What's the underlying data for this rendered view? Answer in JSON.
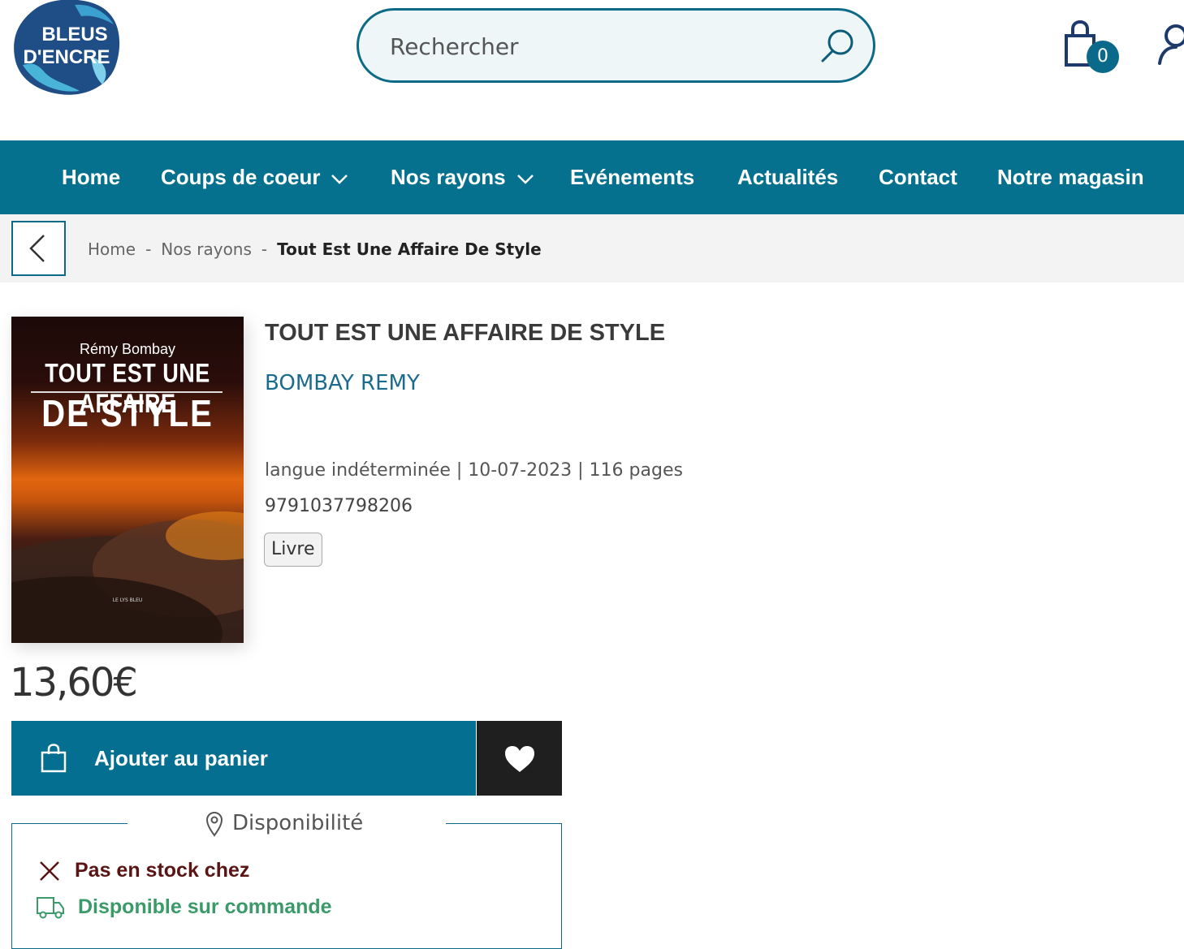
{
  "brand": {
    "logo_line1": "BLEUS",
    "logo_line2": "D'ENCRE"
  },
  "search": {
    "placeholder": "Rechercher"
  },
  "cart": {
    "count": "0"
  },
  "colors": {
    "primary": "#06718f",
    "dark": "#1f1f1f",
    "unavailable": "#5a1414",
    "available": "#3a9a68"
  },
  "nav": {
    "items": [
      {
        "label": "Home"
      },
      {
        "label": "Coups de coeur",
        "dropdown": true
      },
      {
        "label": "Nos rayons",
        "dropdown": true
      },
      {
        "label": "Evénements"
      },
      {
        "label": "Actualités"
      },
      {
        "label": "Contact"
      },
      {
        "label": "Notre magasin"
      }
    ]
  },
  "breadcrumb": {
    "items": [
      "Home",
      "Nos rayons"
    ],
    "current": "Tout Est Une Affaire De Style",
    "separator": "-"
  },
  "cover": {
    "author": "Rémy Bombay",
    "line1": "TOUT EST UNE AFFAIRE",
    "line2": "DE STYLE",
    "publisher": "LE LYS BLEU"
  },
  "product": {
    "title": "TOUT EST UNE AFFAIRE DE STYLE",
    "author": "BOMBAY REMY",
    "meta": "langue indéterminée | 10-07-2023 | 116 pages",
    "isbn": "9791037798206",
    "format": "Livre",
    "price": "13,60€"
  },
  "actions": {
    "add_to_cart": "Ajouter au panier"
  },
  "availability": {
    "title": "Disponibilité",
    "in_store": "Pas en stock chez",
    "order": "Disponible sur commande"
  },
  "icons": [
    "search-icon",
    "shopping-bag-icon",
    "user-icon",
    "chevron-down-icon",
    "chevron-left-icon",
    "heart-icon",
    "map-pin-icon",
    "close-icon",
    "truck-icon"
  ]
}
